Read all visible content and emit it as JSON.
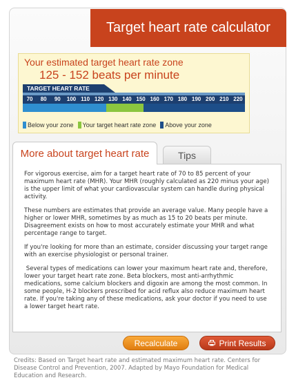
{
  "header": {
    "title": "Target heart rate calculator"
  },
  "zone": {
    "heading": "Your estimated target heart rate zone",
    "value": "125 - 152 beats per minute",
    "scale_label": "TARGET HEART RATE",
    "ticks": [
      "70",
      "80",
      "90",
      "100",
      "110",
      "120",
      "130",
      "140",
      "150",
      "160",
      "170",
      "180",
      "190",
      "200",
      "210",
      "220"
    ],
    "range_min": 65,
    "range_max": 225,
    "zone_low": 125,
    "zone_high": 152,
    "colors": {
      "below": "#2f8fd0",
      "target": "#8cc63f",
      "above": "#1d4e89",
      "track": "#1d3f6f"
    },
    "legend": {
      "below": "Below your zone",
      "target": "Your target heart rate zone",
      "above": "Above your zone"
    }
  },
  "tabs": {
    "active": "More about target heart rate",
    "inactive": "Tips"
  },
  "content": {
    "p1": "For vigorous exercise, aim for a target heart rate of 70 to 85 percent of your maximum heart rate (MHR). Your MHR (roughly calculated as 220 minus your age) is the upper limit of what your cardiovascular system can handle during physical activity.",
    "p2": "These numbers are estimates that provide an average value. Many people have a higher or lower MHR, sometimes by as much as 15 to 20 beats per minute. Disagreement exists on how to most accurately estimate your MHR and what percentage range to target.",
    "p3": "If you're looking for more than an estimate, consider discussing your target range with an exercise physiologist or personal trainer.",
    "p4": " Several types of medications can lower your maximum heart rate and, therefore, lower your target heart rate zone. Beta blockers, most anti-arrhythmic medications, some calcium blockers and digoxin are among the most common. In some people, H-2 blockers prescribed for acid reflux also reduce maximum heart rate. If you're taking any of these medications, ask your doctor if you need to use a lower target heart rate."
  },
  "buttons": {
    "recalculate": "Recalculate",
    "print": "Print Results",
    "print_icon": "printer-icon"
  },
  "credits": "Credits: Based on Target heart rate and estimated maximum heart rate. Centers for Disease Control and Prevention, 2007. Adapted by Mayo Foundation for Medical Education and Research.",
  "brand": {
    "accent": "#c8431d"
  }
}
